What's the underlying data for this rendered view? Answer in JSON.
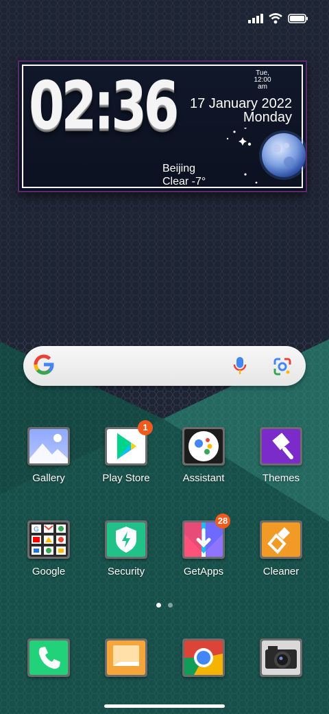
{
  "status_bar": {
    "icons": [
      "signal-icon",
      "wifi-icon",
      "battery-icon"
    ]
  },
  "widget": {
    "time": "02:36",
    "alarm_day": "Tue,",
    "alarm_time": "12:00",
    "alarm_ampm": "am",
    "date": "17 January 2022",
    "weekday": "Monday",
    "city": "Beijing",
    "weather": "Clear -7°"
  },
  "search": {
    "icons": [
      "google-logo-icon",
      "mic-icon",
      "lens-icon"
    ]
  },
  "apps_row1": [
    {
      "label": "Gallery"
    },
    {
      "label": "Play Store",
      "badge": "1"
    },
    {
      "label": "Assistant"
    },
    {
      "label": "Themes"
    }
  ],
  "apps_row2": [
    {
      "label": "Google"
    },
    {
      "label": "Security"
    },
    {
      "label": "GetApps",
      "badge": "28"
    },
    {
      "label": "Cleaner"
    }
  ],
  "dock": {
    "icons": [
      "phone-icon",
      "messages-icon",
      "chrome-icon",
      "camera-icon"
    ]
  },
  "pager": {
    "pages": 2,
    "current": 1
  },
  "colors": {
    "badge": "#f25a1d",
    "widget_border": "#5a2a6e",
    "teal": "#1a5a52"
  }
}
